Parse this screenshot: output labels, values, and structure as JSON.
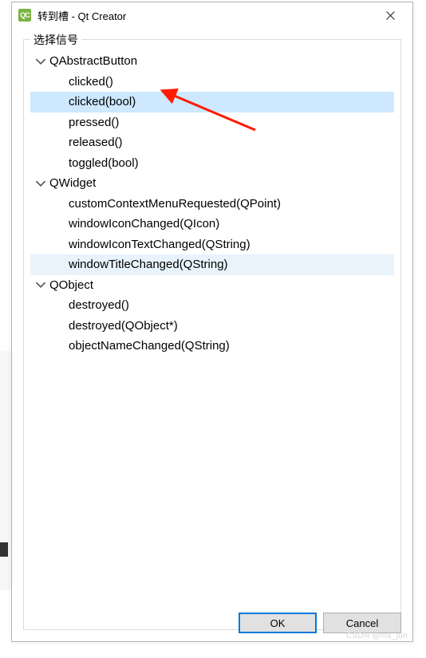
{
  "window": {
    "title": "转到槽 - Qt Creator",
    "app_icon_label": "QC"
  },
  "groupbox": {
    "title": "选择信号"
  },
  "tree": [
    {
      "label": "QAbstractButton",
      "children": [
        {
          "label": "clicked()",
          "state": ""
        },
        {
          "label": "clicked(bool)",
          "state": "selected"
        },
        {
          "label": "pressed()",
          "state": ""
        },
        {
          "label": "released()",
          "state": ""
        },
        {
          "label": "toggled(bool)",
          "state": ""
        }
      ]
    },
    {
      "label": "QWidget",
      "children": [
        {
          "label": "customContextMenuRequested(QPoint)",
          "state": ""
        },
        {
          "label": "windowIconChanged(QIcon)",
          "state": ""
        },
        {
          "label": "windowIconTextChanged(QString)",
          "state": ""
        },
        {
          "label": "windowTitleChanged(QString)",
          "state": "soft"
        }
      ]
    },
    {
      "label": "QObject",
      "children": [
        {
          "label": "destroyed()",
          "state": ""
        },
        {
          "label": "destroyed(QObject*)",
          "state": ""
        },
        {
          "label": "objectNameChanged(QString)",
          "state": ""
        }
      ]
    }
  ],
  "buttons": {
    "ok": "OK",
    "cancel": "Cancel"
  },
  "watermark": "CSDN @mx_jun"
}
